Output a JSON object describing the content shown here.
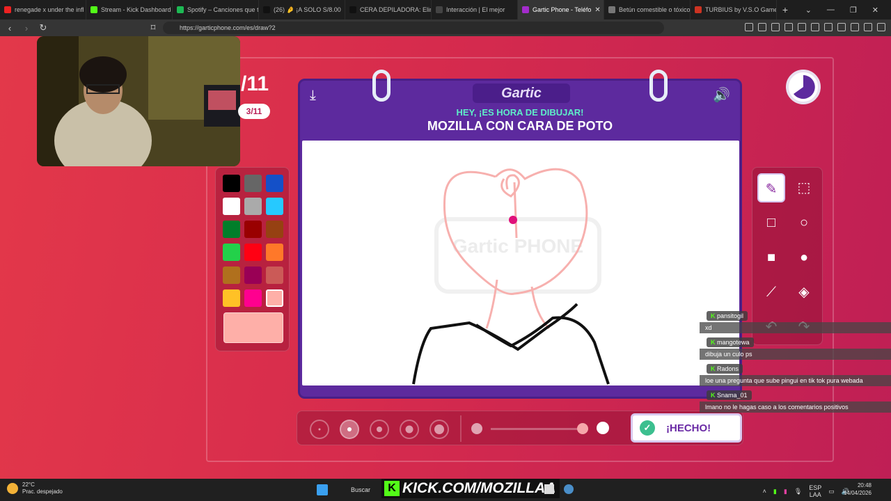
{
  "tabs": [
    {
      "label": "renegade x under the infl",
      "color": "#e22",
      "active": false
    },
    {
      "label": "Stream - Kick Dashboard",
      "color": "#53fc18",
      "active": false
    },
    {
      "label": "Spotify – Canciones que t",
      "color": "#1db954",
      "active": false
    },
    {
      "label": "(26) 🤌 ¡A SOLO S/8.00",
      "color": "#111",
      "active": false
    },
    {
      "label": "CERA DEPILADORA: Elimi",
      "color": "#111",
      "active": false
    },
    {
      "label": "Interacción | El mejor",
      "color": "#444",
      "active": false
    },
    {
      "label": "Gartic Phone - Teléfo",
      "color": "#a32ccc",
      "active": true
    },
    {
      "label": "Betún comestible o tóxico",
      "color": "#777",
      "active": false
    },
    {
      "label": "TURBIUS by V.S.O Games",
      "color": "#c32",
      "active": false
    }
  ],
  "browser": {
    "url": "https://garticphone.com/es/draw?2"
  },
  "game": {
    "round_big": "/11",
    "round_pill": "3/11",
    "brand": "Gartic",
    "hey_text": "HEY, ¡ES HORA DE DIBUJAR!",
    "prompt": "MOZILLA CON CARA DE POTO",
    "done_label": "¡HECHO!",
    "watermark": "Gartic PHONE"
  },
  "palette": {
    "colors": [
      "#000000",
      "#666666",
      "#1450c8",
      "#ffffff",
      "#aaaaaa",
      "#26c9ff",
      "#017e2a",
      "#990000",
      "#964112",
      "#23d14a",
      "#ff0013",
      "#ff7829",
      "#b0701d",
      "#990055",
      "#cb5a57",
      "#ffc126",
      "#ff008f",
      "#feafa8"
    ],
    "current": "#feafa8"
  },
  "tools_icons": [
    "pencil-icon",
    "eraser-icon",
    "rect-outline-icon",
    "circle-outline-icon",
    "rect-fill-icon",
    "circle-fill-icon",
    "line-icon",
    "fill-bucket-icon",
    "undo-icon",
    "redo-icon"
  ],
  "chat": [
    {
      "user": "pansitogil",
      "text": "xd"
    },
    {
      "user": "mangotewa",
      "text": "dibuja un culo ps"
    },
    {
      "user": "Radons",
      "text": "loe una pregunta que sube pingui en tik tok pura webada"
    },
    {
      "user": "Snama_01",
      "text": "lmano no le hagas caso a los comentarios positivos"
    }
  ],
  "taskbar": {
    "temp": "22°C",
    "weather": "Prac. despejado",
    "search": "Buscar",
    "kick": "KICK.COM/MOZILLAA",
    "lang_top": "ESP",
    "lang_bottom": "LAA",
    "time": "20:48",
    "date": "14/04/2026"
  }
}
